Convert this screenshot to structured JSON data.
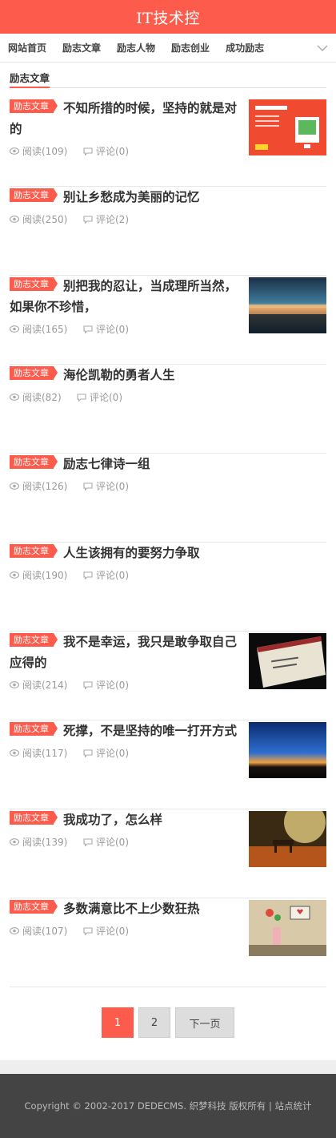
{
  "header": {
    "title": "IT技术控"
  },
  "nav": {
    "items": [
      "网站首页",
      "励志文章",
      "励志人物",
      "励志创业",
      "成功励志"
    ],
    "more_icon": "chevron-down-icon"
  },
  "section": {
    "title": "励志文章"
  },
  "articles": [
    {
      "tag": "励志文章",
      "title": "不知所措的时候，坚持的就是对的",
      "views": "阅读(109)",
      "comments": "评论(0)"
    },
    {
      "tag": "励志文章",
      "title": "别让乡愁成为美丽的记忆",
      "views": "阅读(250)",
      "comments": "评论(2)"
    },
    {
      "tag": "励志文章",
      "title": "别把我的忍让，当成理所当然，如果你不珍惜，",
      "views": "阅读(165)",
      "comments": "评论(0)"
    },
    {
      "tag": "励志文章",
      "title": "海伦凯勒的勇者人生",
      "views": "阅读(82)",
      "comments": "评论(0)"
    },
    {
      "tag": "励志文章",
      "title": "励志七律诗一组",
      "views": "阅读(126)",
      "comments": "评论(0)"
    },
    {
      "tag": "励志文章",
      "title": "人生该拥有的要努力争取",
      "views": "阅读(190)",
      "comments": "评论(0)"
    },
    {
      "tag": "励志文章",
      "title": "我不是幸运，我只是敢争取自己应得的",
      "views": "阅读(214)",
      "comments": "评论(0)"
    },
    {
      "tag": "励志文章",
      "title": "死撑，不是坚持的唯一打开方式",
      "views": "阅读(117)",
      "comments": "评论(0)"
    },
    {
      "tag": "励志文章",
      "title": "我成功了，怎么样",
      "views": "阅读(139)",
      "comments": "评论(0)"
    },
    {
      "tag": "励志文章",
      "title": "多数满意比不上少数狂热",
      "views": "阅读(107)",
      "comments": "评论(0)"
    }
  ],
  "pager": {
    "page1": "1",
    "page2": "2",
    "next": "下一页"
  },
  "footer": {
    "text": "Copyright © 2002-2017 DEDECMS. 织梦科技 版权所有 | 站点统计"
  },
  "colors": {
    "accent": "#fd5c4d",
    "footer_bg": "#444444",
    "muted": "#999999"
  }
}
